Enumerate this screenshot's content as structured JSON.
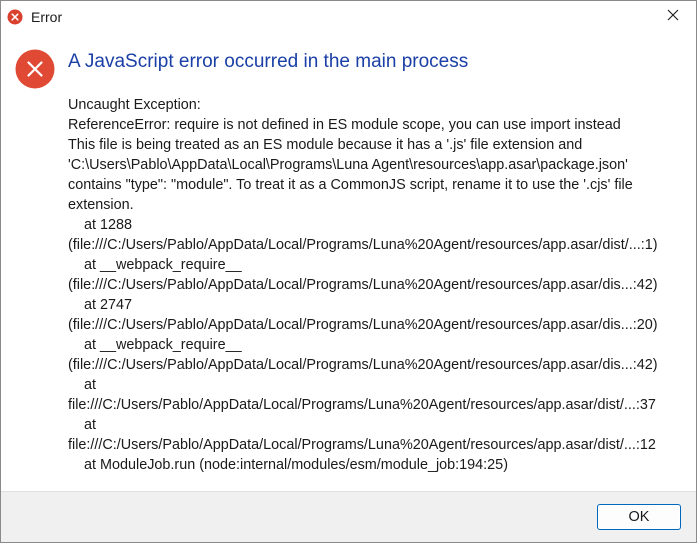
{
  "window": {
    "title": "Error",
    "icon": "error-icon",
    "close_icon": "close-icon"
  },
  "colors": {
    "instruction": "#1a3fa6",
    "error_red": "#e8443a",
    "button_border": "#0067c0",
    "footer_bg": "#f0f0f0"
  },
  "dialog": {
    "main_instruction": "A JavaScript error occurred in the main process",
    "message_lines": [
      "Uncaught Exception:",
      "ReferenceError: require is not defined in ES module scope, you can use import instead",
      "This file is being treated as an ES module because it has a '.js' file extension and",
      "'C:\\Users\\Pablo\\AppData\\Local\\Programs\\Luna Agent\\resources\\app.asar\\package.json'",
      "contains \"type\": \"module\". To treat it as a CommonJS script, rename it to use the '.cjs' file",
      "extension.",
      "at 1288",
      "(file:///C:/Users/Pablo/AppData/Local/Programs/Luna%20Agent/resources/app.asar/dist/...:1)",
      "at __webpack_require__",
      "(file:///C:/Users/Pablo/AppData/Local/Programs/Luna%20Agent/resources/app.asar/dis...:42)",
      "at 2747",
      "(file:///C:/Users/Pablo/AppData/Local/Programs/Luna%20Agent/resources/app.asar/dis...:20)",
      "at __webpack_require__",
      "(file:///C:/Users/Pablo/AppData/Local/Programs/Luna%20Agent/resources/app.asar/dis...:42)",
      "at",
      "file:///C:/Users/Pablo/AppData/Local/Programs/Luna%20Agent/resources/app.asar/dist/...:37",
      "at",
      "file:///C:/Users/Pablo/AppData/Local/Programs/Luna%20Agent/resources/app.asar/dist/...:12",
      "at ModuleJob.run (node:internal/modules/esm/module_job:194:25)"
    ]
  },
  "buttons": {
    "ok_label": "OK"
  }
}
